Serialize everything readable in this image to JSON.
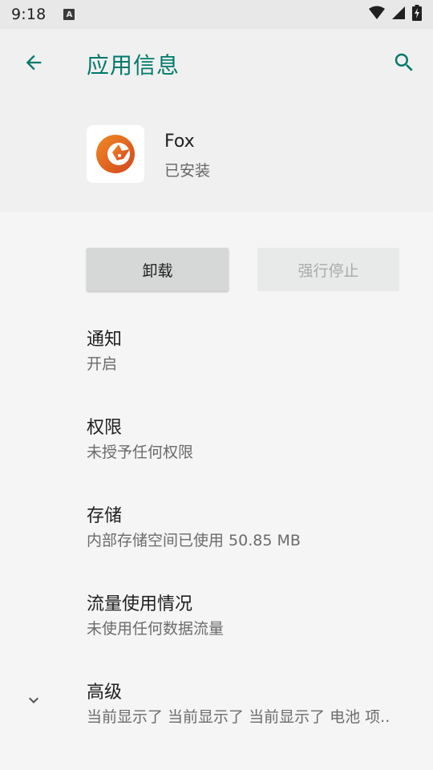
{
  "status_bar": {
    "time": "9:18",
    "a_label": "A",
    "icons": [
      "wifi-icon",
      "signal-icon",
      "battery-charging-icon"
    ]
  },
  "toolbar": {
    "title": "应用信息",
    "back_icon": "arrow-left-icon",
    "search_icon": "search-icon",
    "accent_color": "#00796b"
  },
  "app": {
    "name": "Fox",
    "status": "已安装",
    "icon": "fox-logo-icon"
  },
  "buttons": {
    "uninstall": "卸载",
    "force_stop": "强行停止"
  },
  "items": [
    {
      "title": "通知",
      "summary": "开启"
    },
    {
      "title": "权限",
      "summary": "未授予任何权限"
    },
    {
      "title": "存储",
      "summary": "内部存储空间已使用 50.85 MB"
    },
    {
      "title": "流量使用情况",
      "summary": "未使用任何数据流量"
    },
    {
      "title": "高级",
      "summary": "当前显示了 当前显示了 当前显示了 电池 项.."
    }
  ]
}
